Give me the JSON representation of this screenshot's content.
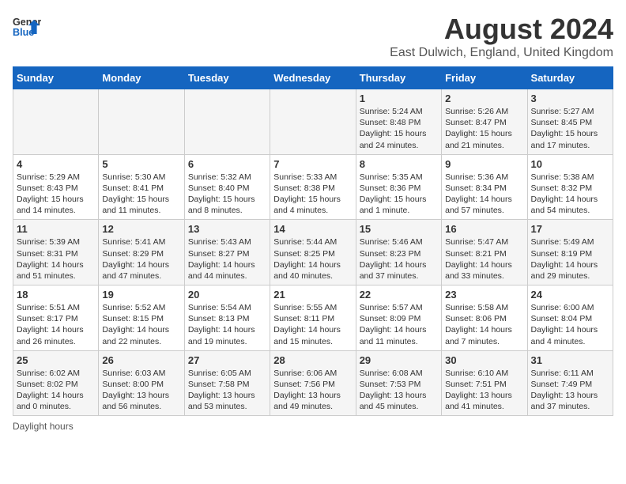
{
  "header": {
    "logo_general": "General",
    "logo_blue": "Blue",
    "month_title": "August 2024",
    "location": "East Dulwich, England, United Kingdom"
  },
  "days_of_week": [
    "Sunday",
    "Monday",
    "Tuesday",
    "Wednesday",
    "Thursday",
    "Friday",
    "Saturday"
  ],
  "weeks": [
    [
      {
        "day": "",
        "info": ""
      },
      {
        "day": "",
        "info": ""
      },
      {
        "day": "",
        "info": ""
      },
      {
        "day": "",
        "info": ""
      },
      {
        "day": "1",
        "info": "Sunrise: 5:24 AM\nSunset: 8:48 PM\nDaylight: 15 hours and 24 minutes."
      },
      {
        "day": "2",
        "info": "Sunrise: 5:26 AM\nSunset: 8:47 PM\nDaylight: 15 hours and 21 minutes."
      },
      {
        "day": "3",
        "info": "Sunrise: 5:27 AM\nSunset: 8:45 PM\nDaylight: 15 hours and 17 minutes."
      }
    ],
    [
      {
        "day": "4",
        "info": "Sunrise: 5:29 AM\nSunset: 8:43 PM\nDaylight: 15 hours and 14 minutes."
      },
      {
        "day": "5",
        "info": "Sunrise: 5:30 AM\nSunset: 8:41 PM\nDaylight: 15 hours and 11 minutes."
      },
      {
        "day": "6",
        "info": "Sunrise: 5:32 AM\nSunset: 8:40 PM\nDaylight: 15 hours and 8 minutes."
      },
      {
        "day": "7",
        "info": "Sunrise: 5:33 AM\nSunset: 8:38 PM\nDaylight: 15 hours and 4 minutes."
      },
      {
        "day": "8",
        "info": "Sunrise: 5:35 AM\nSunset: 8:36 PM\nDaylight: 15 hours and 1 minute."
      },
      {
        "day": "9",
        "info": "Sunrise: 5:36 AM\nSunset: 8:34 PM\nDaylight: 14 hours and 57 minutes."
      },
      {
        "day": "10",
        "info": "Sunrise: 5:38 AM\nSunset: 8:32 PM\nDaylight: 14 hours and 54 minutes."
      }
    ],
    [
      {
        "day": "11",
        "info": "Sunrise: 5:39 AM\nSunset: 8:31 PM\nDaylight: 14 hours and 51 minutes."
      },
      {
        "day": "12",
        "info": "Sunrise: 5:41 AM\nSunset: 8:29 PM\nDaylight: 14 hours and 47 minutes."
      },
      {
        "day": "13",
        "info": "Sunrise: 5:43 AM\nSunset: 8:27 PM\nDaylight: 14 hours and 44 minutes."
      },
      {
        "day": "14",
        "info": "Sunrise: 5:44 AM\nSunset: 8:25 PM\nDaylight: 14 hours and 40 minutes."
      },
      {
        "day": "15",
        "info": "Sunrise: 5:46 AM\nSunset: 8:23 PM\nDaylight: 14 hours and 37 minutes."
      },
      {
        "day": "16",
        "info": "Sunrise: 5:47 AM\nSunset: 8:21 PM\nDaylight: 14 hours and 33 minutes."
      },
      {
        "day": "17",
        "info": "Sunrise: 5:49 AM\nSunset: 8:19 PM\nDaylight: 14 hours and 29 minutes."
      }
    ],
    [
      {
        "day": "18",
        "info": "Sunrise: 5:51 AM\nSunset: 8:17 PM\nDaylight: 14 hours and 26 minutes."
      },
      {
        "day": "19",
        "info": "Sunrise: 5:52 AM\nSunset: 8:15 PM\nDaylight: 14 hours and 22 minutes."
      },
      {
        "day": "20",
        "info": "Sunrise: 5:54 AM\nSunset: 8:13 PM\nDaylight: 14 hours and 19 minutes."
      },
      {
        "day": "21",
        "info": "Sunrise: 5:55 AM\nSunset: 8:11 PM\nDaylight: 14 hours and 15 minutes."
      },
      {
        "day": "22",
        "info": "Sunrise: 5:57 AM\nSunset: 8:09 PM\nDaylight: 14 hours and 11 minutes."
      },
      {
        "day": "23",
        "info": "Sunrise: 5:58 AM\nSunset: 8:06 PM\nDaylight: 14 hours and 7 minutes."
      },
      {
        "day": "24",
        "info": "Sunrise: 6:00 AM\nSunset: 8:04 PM\nDaylight: 14 hours and 4 minutes."
      }
    ],
    [
      {
        "day": "25",
        "info": "Sunrise: 6:02 AM\nSunset: 8:02 PM\nDaylight: 14 hours and 0 minutes."
      },
      {
        "day": "26",
        "info": "Sunrise: 6:03 AM\nSunset: 8:00 PM\nDaylight: 13 hours and 56 minutes."
      },
      {
        "day": "27",
        "info": "Sunrise: 6:05 AM\nSunset: 7:58 PM\nDaylight: 13 hours and 53 minutes."
      },
      {
        "day": "28",
        "info": "Sunrise: 6:06 AM\nSunset: 7:56 PM\nDaylight: 13 hours and 49 minutes."
      },
      {
        "day": "29",
        "info": "Sunrise: 6:08 AM\nSunset: 7:53 PM\nDaylight: 13 hours and 45 minutes."
      },
      {
        "day": "30",
        "info": "Sunrise: 6:10 AM\nSunset: 7:51 PM\nDaylight: 13 hours and 41 minutes."
      },
      {
        "day": "31",
        "info": "Sunrise: 6:11 AM\nSunset: 7:49 PM\nDaylight: 13 hours and 37 minutes."
      }
    ]
  ],
  "footer": {
    "note": "Daylight hours"
  }
}
